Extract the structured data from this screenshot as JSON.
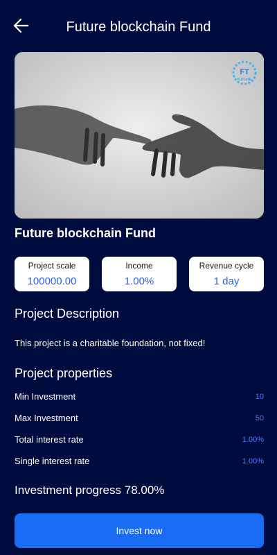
{
  "header": {
    "title": "Future blockchain Fund",
    "back_icon": "arrow-left-icon"
  },
  "hero": {
    "logo_text": "FT",
    "logo_subtext": "FUTURE"
  },
  "fund": {
    "name": "Future blockchain Fund"
  },
  "stats": [
    {
      "label": "Project scale",
      "value": "100000.00"
    },
    {
      "label": "Income",
      "value": "1.00%"
    },
    {
      "label": "Revenue cycle",
      "value": "1 day"
    }
  ],
  "description": {
    "title": "Project Description",
    "text": "This project is a charitable foundation, not fixed!"
  },
  "properties": {
    "title": "Project properties",
    "items": [
      {
        "label": "Min Investment",
        "value": "10"
      },
      {
        "label": "Max Investment",
        "value": "50"
      },
      {
        "label": "Total interest rate",
        "value": "1.00%"
      },
      {
        "label": "Single interest rate",
        "value": "1.00%"
      }
    ]
  },
  "progress": {
    "text": "Investment progress 78.00%",
    "percent": 78
  },
  "invest_button": {
    "label": "Invest now"
  },
  "colors": {
    "background": "#000b3e",
    "accent": "#1a6cf5",
    "value_blue": "#2a63e8"
  }
}
